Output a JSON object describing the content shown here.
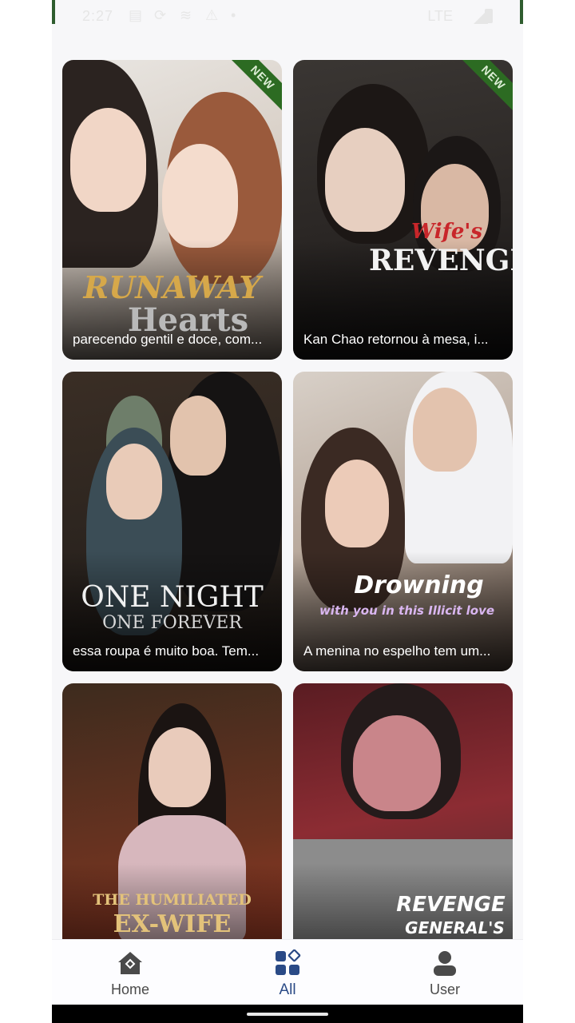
{
  "status_bar": {
    "time": "2:27",
    "network": "LTE"
  },
  "cards": [
    {
      "title_line1": "RUNAWAY",
      "title_line2": "Hearts",
      "caption": "parecendo gentil e doce, com...",
      "badge": "NEW"
    },
    {
      "title_line1": "Wife's",
      "title_line2": "REVENGE",
      "caption": "Kan Chao retornou à mesa, i...",
      "badge": "NEW"
    },
    {
      "title_line1": "ONE NIGHT",
      "title_line2": "ONE FOREVER",
      "caption": "essa roupa é muito boa. Tem...",
      "badge": ""
    },
    {
      "title_line1": "Drowning",
      "title_line2": "with you in this Illicit love",
      "caption": "A menina no espelho tem um...",
      "badge": ""
    },
    {
      "title_line1": "THE HUMILIATED",
      "title_line2": "EX-WIFE",
      "caption": "",
      "badge": ""
    },
    {
      "title_line1": "REVENGE",
      "title_line2": "GENERAL'S",
      "caption": "",
      "badge": ""
    }
  ],
  "nav": {
    "items": [
      {
        "label": "Home",
        "icon": "home-icon"
      },
      {
        "label": "All",
        "icon": "grid-icon"
      },
      {
        "label": "User",
        "icon": "user-icon"
      }
    ],
    "active": "All",
    "active_color": "#2a4a86"
  }
}
